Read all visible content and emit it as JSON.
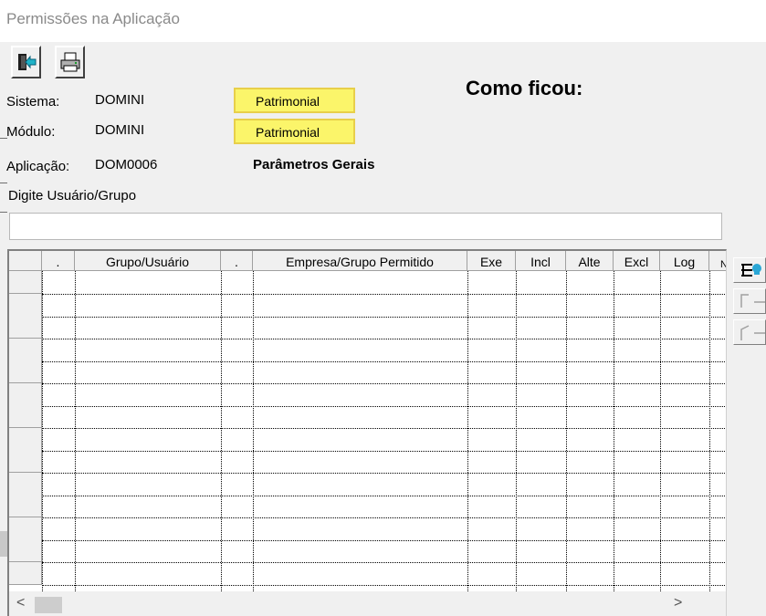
{
  "window": {
    "title": "Permissões na Aplicação"
  },
  "toolbar": {
    "exit_icon": "exit-door-icon",
    "print_icon": "print-icon"
  },
  "info": {
    "sistema_label": "Sistema:",
    "sistema_value": "DOMINI",
    "sistema_desc": "Patrimonial",
    "modulo_label": "Módulo:",
    "modulo_value": "DOMINI",
    "modulo_desc": "Patrimonial",
    "aplicacao_label": "Aplicação:",
    "aplicacao_value": "DOM0006",
    "aplicacao_desc": "Parâmetros Gerais"
  },
  "heading": "Como ficou:",
  "search": {
    "label": "Digite Usuário/Grupo",
    "value": ""
  },
  "grid": {
    "columns": [
      ".",
      "Grupo/Usuário",
      ".",
      "Empresa/Grupo Permitido",
      "Exe",
      "Incl",
      "Alte",
      "Excl",
      "Log"
    ],
    "row_count": 14,
    "partial_col_label": "N"
  },
  "scroll": {
    "left_arrow": "<",
    "right_arrow": ">"
  },
  "side_buttons": [
    "add-user-icon",
    "move-right-icon",
    "move-left-icon"
  ]
}
